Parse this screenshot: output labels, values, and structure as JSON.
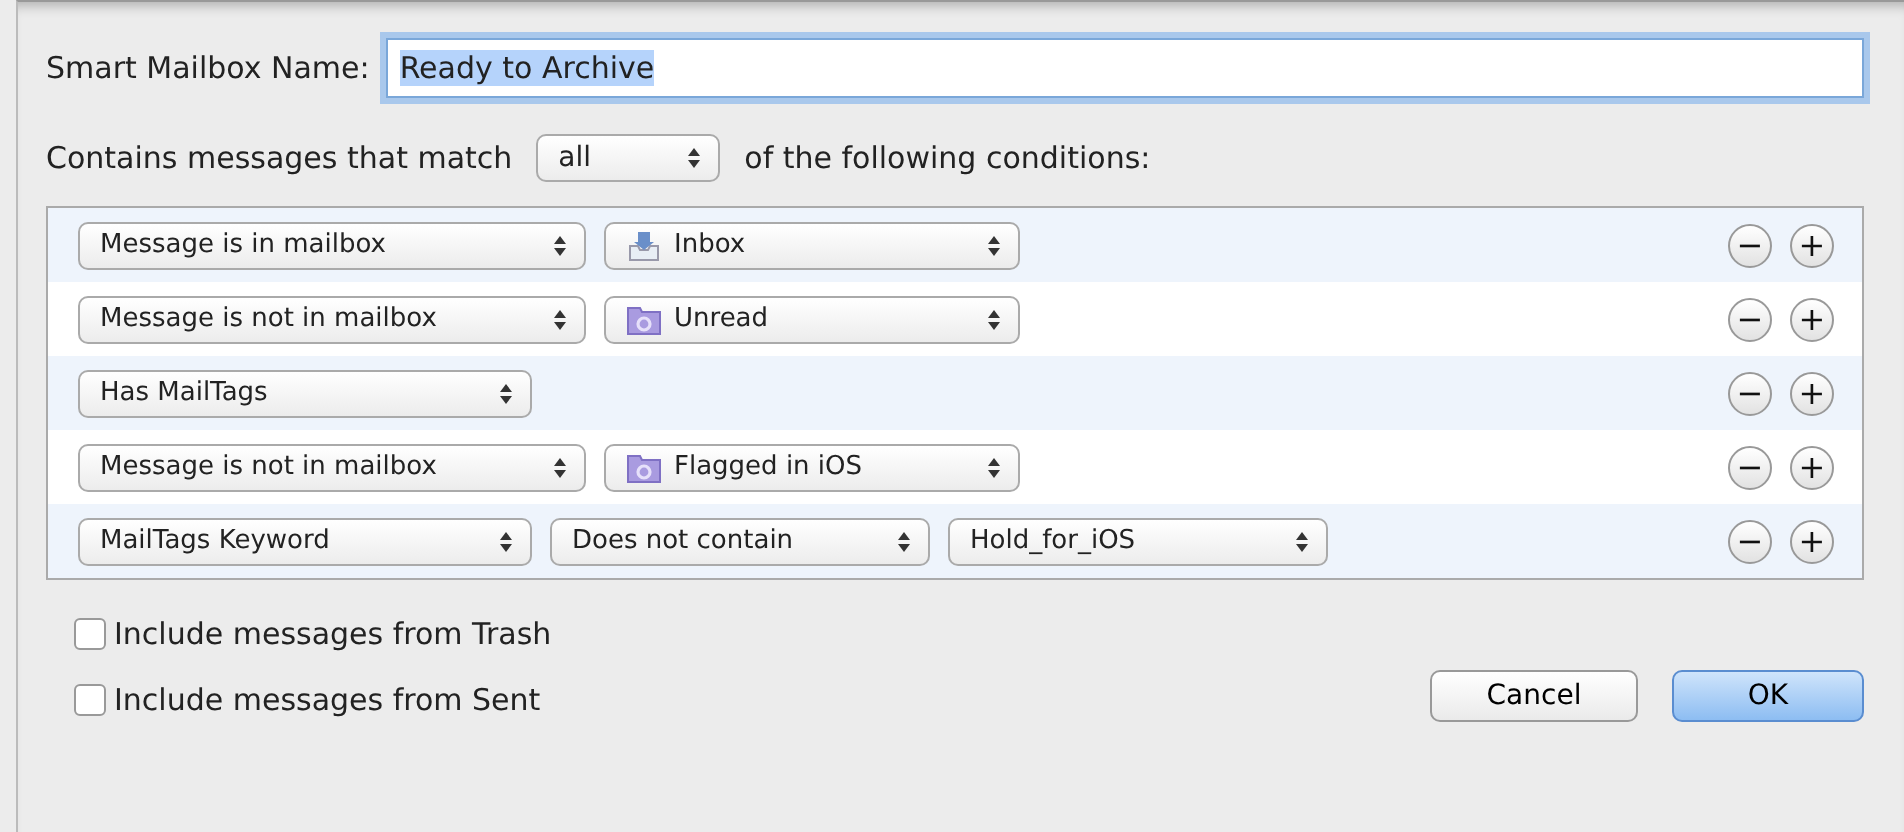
{
  "name_field": {
    "label": "Smart Mailbox Name:",
    "value": "Ready to Archive",
    "text_selected": true
  },
  "match": {
    "before": "Contains messages that match",
    "value": "all",
    "after": "of the following conditions:"
  },
  "conditions": [
    {
      "popups": [
        {
          "text": "Message is in mailbox"
        },
        {
          "text": "Inbox",
          "kind": "inbox"
        }
      ],
      "remove": "−",
      "add": "+"
    },
    {
      "popups": [
        {
          "text": "Message is not in mailbox"
        },
        {
          "text": "Unread",
          "kind": "smartfolder"
        }
      ],
      "remove": "−",
      "add": "+"
    },
    {
      "popups": [
        {
          "text": "Has MailTags"
        }
      ],
      "remove": "−",
      "add": "+"
    },
    {
      "popups": [
        {
          "text": "Message is not in mailbox"
        },
        {
          "text": "Flagged in iOS",
          "kind": "smartfolder"
        }
      ],
      "remove": "−",
      "add": "+"
    },
    {
      "popups": [
        {
          "text": "MailTags Keyword"
        },
        {
          "text": "Does not contain"
        },
        {
          "text": "Hold_for_iOS"
        }
      ],
      "remove": "−",
      "add": "+"
    }
  ],
  "options": [
    {
      "label": "Include messages from Trash",
      "checked": false
    },
    {
      "label": "Include messages from Sent",
      "checked": false
    }
  ],
  "buttons": [
    {
      "label": "Cancel",
      "default": false
    },
    {
      "label": "OK",
      "default": true
    }
  ]
}
